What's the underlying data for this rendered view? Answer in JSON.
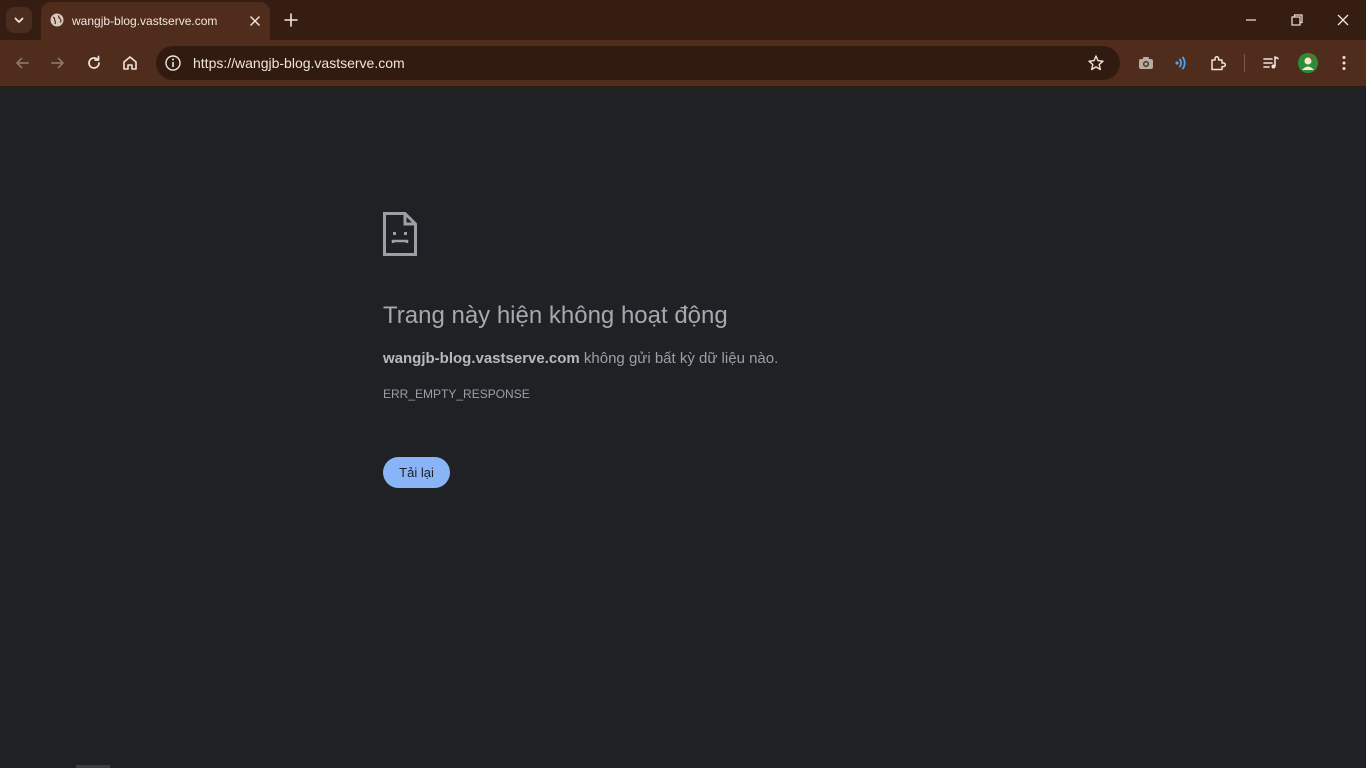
{
  "browser": {
    "tab": {
      "title": "wangjb-blog.vastserve.com"
    },
    "omnibox": {
      "url": "https://wangjb-blog.vastserve.com"
    }
  },
  "error_page": {
    "title": "Trang này hiện không hoạt động",
    "host": "wangjb-blog.vastserve.com",
    "description_suffix": " không gửi bất kỳ dữ liệu nào.",
    "code": "ERR_EMPTY_RESPONSE",
    "reload_label": "Tải lại"
  },
  "colors": {
    "tabbar_bg": "#351d12",
    "toolbar_bg": "#4f2c1c",
    "omnibox_bg": "#311b11",
    "page_bg": "#202124",
    "reload_button": "#8ab4f8"
  }
}
